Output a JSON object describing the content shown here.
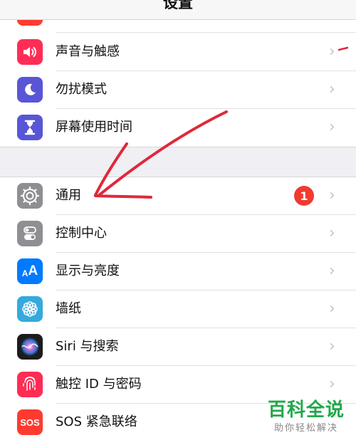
{
  "header": {
    "title": "设置"
  },
  "group1": {
    "rows": [
      {
        "label": "声音与触感",
        "icon": "speaker-icon",
        "color": "#ff2d55"
      },
      {
        "label": "勿扰模式",
        "icon": "moon-icon",
        "color": "#5856d6"
      },
      {
        "label": "屏幕使用时间",
        "icon": "hourglass-icon",
        "color": "#5856d6"
      }
    ]
  },
  "group2": {
    "rows": [
      {
        "label": "通用",
        "icon": "gear-icon",
        "color": "#8e8e93",
        "badge": "1"
      },
      {
        "label": "控制中心",
        "icon": "toggles-icon",
        "color": "#8e8e93"
      },
      {
        "label": "显示与亮度",
        "icon": "text-size-icon",
        "color": "#007aff"
      },
      {
        "label": "墙纸",
        "icon": "flower-icon",
        "color": "#34aadc"
      },
      {
        "label": "Siri 与搜索",
        "icon": "siri-icon",
        "color": "#222222"
      },
      {
        "label": "触控 ID 与密码",
        "icon": "fingerprint-icon",
        "color": "#ff2d55"
      },
      {
        "label": "SOS 紧急联络",
        "icon": "sos-icon",
        "color": "#ff3b30",
        "icon_text": "SOS"
      }
    ]
  },
  "watermark": {
    "title": "百科全说",
    "subtitle": "助你轻松解决"
  },
  "colors": {
    "annotation": "#e0283a",
    "badge": "#f03b30",
    "watermark": "#22a84a"
  }
}
